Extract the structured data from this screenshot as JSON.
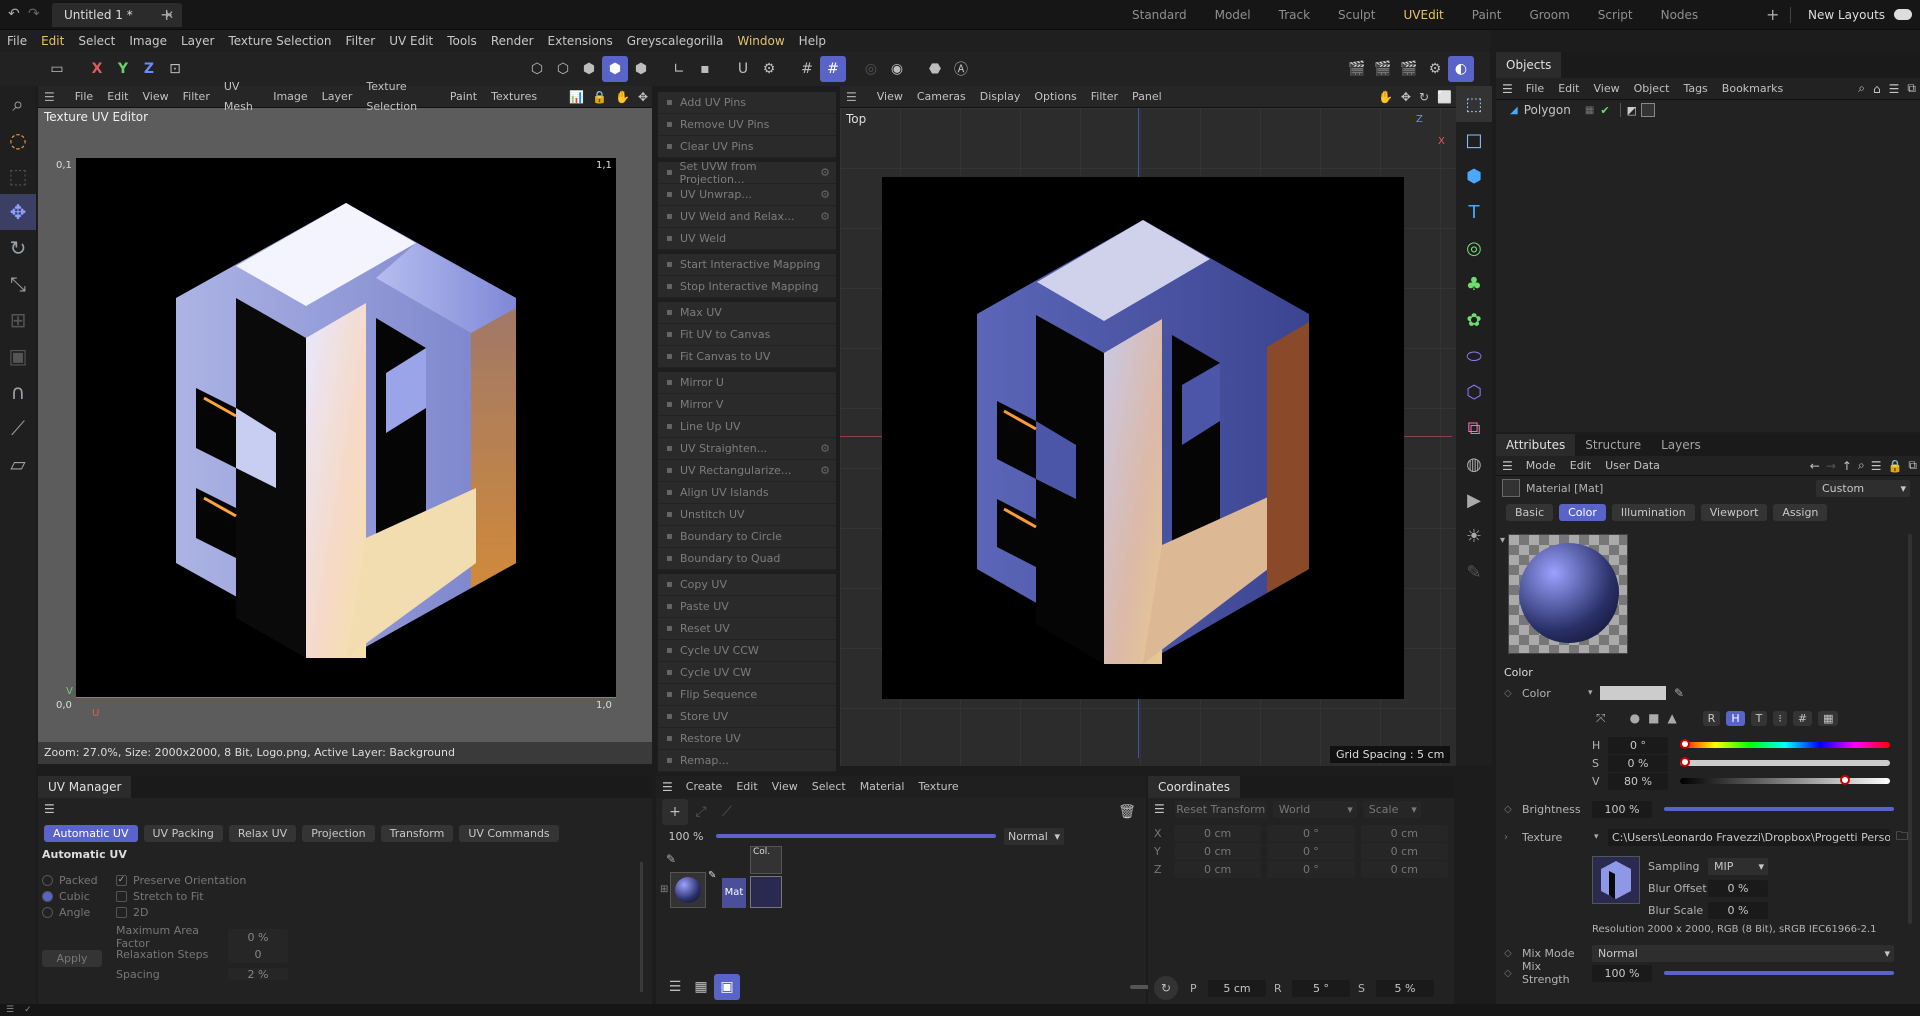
{
  "titlebar": {
    "doc_tab": "Untitled 1 *",
    "layouts": [
      "Standard",
      "Model",
      "Track",
      "Sculpt",
      "UVEdit",
      "Paint",
      "Groom",
      "Script",
      "Nodes"
    ],
    "active_layout": "UVEdit",
    "new_layouts": "New Layouts"
  },
  "menubar": {
    "items": [
      "File",
      "Edit",
      "Select",
      "Image",
      "Layer",
      "Texture Selection",
      "Filter",
      "UV Edit",
      "Tools",
      "Render",
      "Extensions",
      "Greyscalegorilla",
      "Window",
      "Help"
    ]
  },
  "toolbar": {
    "axes": [
      "X",
      "Y",
      "Z"
    ]
  },
  "uv_editor": {
    "menu": [
      "File",
      "Edit",
      "View",
      "Filter",
      "UV Mesh",
      "Image",
      "Layer",
      "Texture Selection",
      "Paint",
      "Textures"
    ],
    "title": "Texture UV Editor",
    "corner_tl": "0,1",
    "corner_tr": "1,1",
    "corner_bl": "0,0",
    "corner_br": "1,0",
    "axis_v": "V",
    "axis_u": "U",
    "status": "Zoom: 27.0%, Size: 2000x2000, 8 Bit, Logo.png, Active Layer: Background"
  },
  "uv_commands": {
    "groups": [
      [
        "Add UV Pins",
        "Remove UV Pins",
        "Clear UV Pins"
      ],
      [
        "Set UVW from Projection...",
        "UV Unwrap...",
        "UV Weld and Relax...",
        "UV Weld"
      ],
      [
        "Start Interactive Mapping",
        "Stop Interactive Mapping"
      ],
      [
        "Max UV",
        "Fit UV to Canvas",
        "Fit Canvas to UV"
      ],
      [
        "Mirror U",
        "Mirror V",
        "Line Up UV",
        "UV Straighten...",
        "UV Rectangularize...",
        "Align UV Islands",
        "Unstitch UV",
        "Boundary to Circle",
        "Boundary to Quad"
      ],
      [
        "Copy UV",
        "Paste UV",
        "Reset UV",
        "Cycle UV CCW",
        "Cycle UV CW",
        "Flip Sequence",
        "Store UV",
        "Restore UV",
        "Remap..."
      ]
    ]
  },
  "viewport": {
    "menu": [
      "View",
      "Cameras",
      "Display",
      "Options",
      "Filter",
      "Panel"
    ],
    "view_name": "Top",
    "grid_spacing": "Grid Spacing : 5 cm",
    "gizmo_z": "Z",
    "gizmo_x": "X"
  },
  "objects": {
    "tabs": [
      "Objects"
    ],
    "menu": [
      "File",
      "Edit",
      "View",
      "Object",
      "Tags",
      "Bookmarks"
    ],
    "items": [
      {
        "name": "Polygon"
      }
    ]
  },
  "attributes": {
    "tabs": [
      "Attributes",
      "Structure",
      "Layers"
    ],
    "menu": [
      "Mode",
      "Edit",
      "User Data"
    ],
    "material_name": "Material [Mat]",
    "preset": "Custom",
    "subtabs": [
      "Basic",
      "Color",
      "Illumination",
      "Viewport",
      "Assign"
    ],
    "active_subtab": "Color",
    "section": "Color",
    "color_label": "Color",
    "color_mode_buttons": [
      "R",
      "H",
      "T",
      "#"
    ],
    "hsv": [
      {
        "label": "H",
        "value": "0 °"
      },
      {
        "label": "S",
        "value": "0 %"
      },
      {
        "label": "V",
        "value": "80 %"
      }
    ],
    "v_level": 0.8,
    "brightness_label": "Brightness",
    "brightness": "100 %",
    "texture_label": "Texture",
    "texture_path": "C:\\Users\\Leonardo Fravezzi\\Dropbox\\Progetti Person",
    "sampling_label": "Sampling",
    "sampling": "MIP",
    "blur_offset_label": "Blur Offset",
    "blur_offset": "0 %",
    "blur_scale_label": "Blur Scale",
    "blur_scale": "0 %",
    "resolution": "Resolution 2000 x 2000, RGB (8 Bit), sRGB IEC61966-2.1",
    "mix_mode_label": "Mix Mode",
    "mix_mode": "Normal",
    "mix_strength_label": "Mix Strength",
    "mix_strength": "100 %"
  },
  "uv_manager": {
    "title": "UV Manager",
    "tabs": [
      "Automatic UV",
      "UV Packing",
      "Relax UV",
      "Projection",
      "Transform",
      "UV Commands"
    ],
    "active_tab": "Automatic UV",
    "section": "Automatic UV",
    "options": [
      "Packed",
      "Cubic",
      "Angle"
    ],
    "selected_option": "Cubic",
    "checks": [
      "Preserve Orientation",
      "Stretch to Fit",
      "2D"
    ],
    "max_area_label": "Maximum Area Factor",
    "max_area": "0 %",
    "relax_label": "Relaxation Steps",
    "relax": "0",
    "spacing_label": "Spacing",
    "spacing": "2 %",
    "apply": "Apply"
  },
  "material_manager": {
    "menu": [
      "Create",
      "Edit",
      "View",
      "Select",
      "Material",
      "Texture"
    ],
    "zoom": "100 %",
    "blend": "Normal",
    "mat_label": "Mat",
    "col_label": "Col."
  },
  "coordinates": {
    "title": "Coordinates",
    "reset": "Reset Transform",
    "space": "World",
    "mode": "Scale",
    "rows": [
      {
        "axis": "X",
        "pos": "0 cm",
        "rot": "0 °",
        "size": "0 cm"
      },
      {
        "axis": "Y",
        "pos": "0 cm",
        "rot": "0 °",
        "size": "0 cm"
      },
      {
        "axis": "Z",
        "pos": "0 cm",
        "rot": "0 °",
        "size": "0 cm"
      }
    ],
    "p_label": "P",
    "p_value": "5 cm",
    "r_label": "R",
    "r_value": "5 °",
    "s_label": "S",
    "s_value": "5 %"
  },
  "colors": {
    "accent": "#5a64c8",
    "active_menu": "#e6c26a"
  }
}
